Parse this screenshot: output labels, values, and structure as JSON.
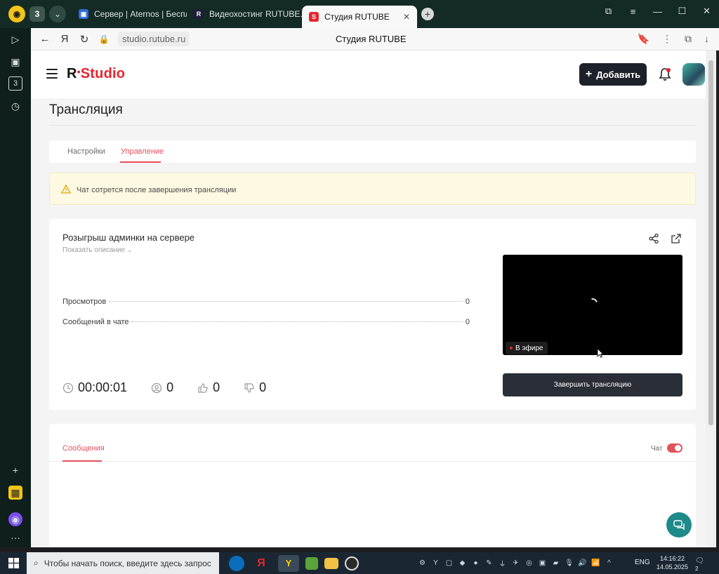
{
  "browser": {
    "tab_count": "3",
    "tabs": [
      {
        "label": "Сервер | Aternos | Беспла"
      },
      {
        "label": "Видеохостинг RUTUBE. С"
      },
      {
        "label": "Студия RUTUBE"
      }
    ],
    "url": "studio.rutube.ru",
    "page_title": "Студия RUTUBE",
    "sidebar_badge": "3"
  },
  "header": {
    "logo": "R",
    "logo_suffix": "Studio",
    "add_button": "Добавить"
  },
  "page": {
    "title": "Трансляция",
    "tabs": [
      {
        "label": "Настройки",
        "active": false
      },
      {
        "label": "Управление",
        "active": true
      }
    ],
    "warning": "Чат сотрется после завершения трансляции"
  },
  "stream": {
    "title": "Розыгрыш админки на сервере",
    "show_description": "Показать описание",
    "stats": [
      {
        "label": "Просмотров",
        "value": "0"
      },
      {
        "label": "Сообщений в чате",
        "value": "0"
      }
    ],
    "duration": "00:00:01",
    "viewers": "0",
    "likes": "0",
    "dislikes": "0",
    "live_label": "В эфире",
    "end_button": "Завершить трансляцию"
  },
  "chat_panel": {
    "tab_label": "Сообщения",
    "chat_toggle_label": "Чат",
    "chat_enabled": true
  },
  "taskbar": {
    "search_placeholder": "Чтобы начать поиск, введите здесь запрос",
    "language": "ENG",
    "time": "14:16:22",
    "date": "14.05.2025",
    "notifications": "2"
  },
  "colors": {
    "accent": "#e6505c",
    "logo_red": "#e6252f",
    "dark_button": "#1d2129"
  }
}
